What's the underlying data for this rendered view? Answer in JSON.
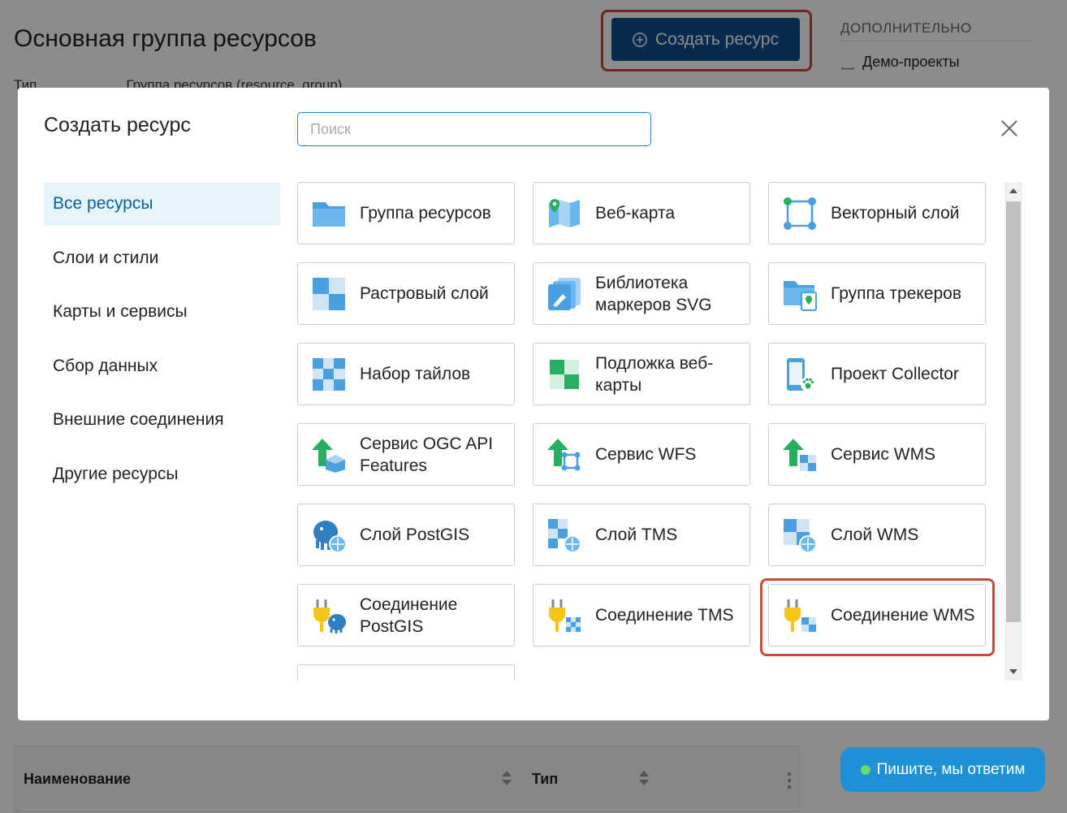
{
  "page": {
    "title": "Основная группа ресурсов",
    "create_button": "Создать ресурс",
    "type_label": "Тип",
    "type_value": "Группа ресурсов (resource_group)",
    "side_header": "ДОПОЛНИТЕЛЬНО",
    "side_link": "Демо-проекты",
    "table": {
      "col_name": "Наименование",
      "col_type": "Тип"
    },
    "chat_button": "Пишите, мы ответим"
  },
  "modal": {
    "title": "Создать ресурс",
    "search_placeholder": "Поиск",
    "categories": [
      {
        "label": "Все ресурсы",
        "active": true
      },
      {
        "label": "Слои и стили"
      },
      {
        "label": "Карты и сервисы"
      },
      {
        "label": "Сбор данных"
      },
      {
        "label": "Внешние соединения"
      },
      {
        "label": "Другие ресурсы"
      }
    ],
    "resources": [
      {
        "label": "Группа ресурсов",
        "icon": "folder-icon"
      },
      {
        "label": "Веб-карта",
        "icon": "webmap-icon"
      },
      {
        "label": "Векторный слой",
        "icon": "vector-layer-icon"
      },
      {
        "label": "Растровый слой",
        "icon": "raster-layer-icon"
      },
      {
        "label": "Библиотека маркеров SVG",
        "icon": "svg-marker-library-icon"
      },
      {
        "label": "Группа трекеров",
        "icon": "tracker-group-icon"
      },
      {
        "label": "Набор тайлов",
        "icon": "tileset-icon"
      },
      {
        "label": "Подложка веб-карты",
        "icon": "basemap-icon"
      },
      {
        "label": "Проект Collector",
        "icon": "collector-project-icon"
      },
      {
        "label": "Сервис OGC API Features",
        "icon": "ogcapi-service-icon"
      },
      {
        "label": "Сервис WFS",
        "icon": "wfs-service-icon"
      },
      {
        "label": "Сервис WMS",
        "icon": "wms-service-icon"
      },
      {
        "label": "Слой PostGIS",
        "icon": "postgis-layer-icon"
      },
      {
        "label": "Слой TMS",
        "icon": "tms-layer-icon"
      },
      {
        "label": "Слой WMS",
        "icon": "wms-layer-icon"
      },
      {
        "label": "Соединение PostGIS",
        "icon": "postgis-connection-icon"
      },
      {
        "label": "Соединение TMS",
        "icon": "tms-connection-icon"
      },
      {
        "label": "Соединение WMS",
        "icon": "wms-connection-icon",
        "highlighted": true
      },
      {
        "label": "",
        "icon": "partially-visible-icon"
      }
    ]
  },
  "colors": {
    "accent": "#0b4f8a",
    "highlight": "#c9493b",
    "chat": "#1e90d6"
  }
}
